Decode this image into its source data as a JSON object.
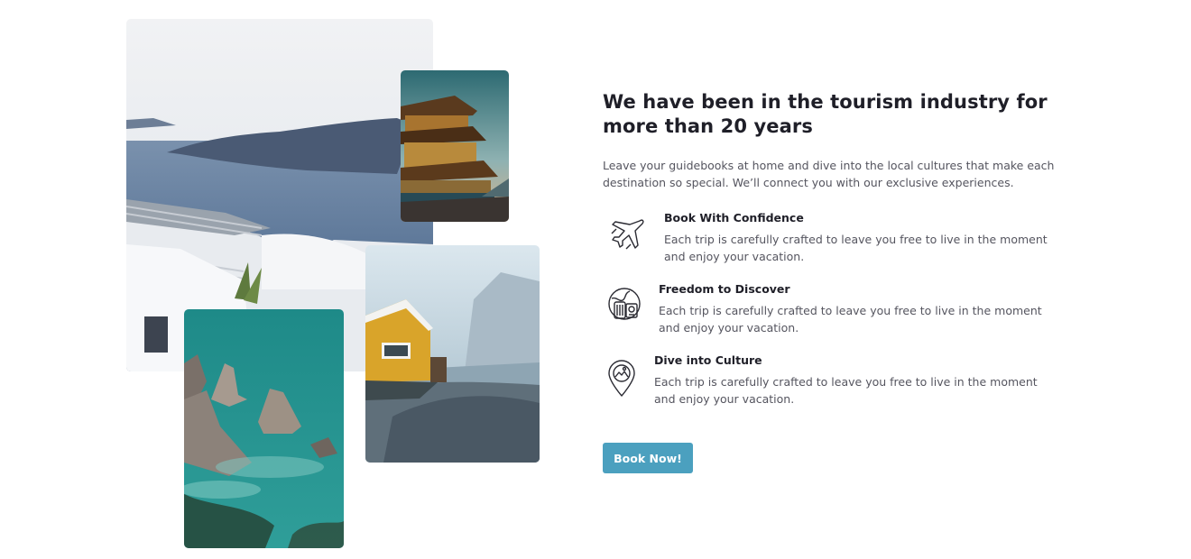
{
  "about": {
    "headline": "We have been in the tourism industry for more than 20 years",
    "intro": "Leave your guidebooks at home and dive into the local cultures that make each destination so special. We’ll connect you with our exclusive experiences."
  },
  "features": [
    {
      "icon": "airplane-icon",
      "title": "Book With Confidence",
      "description": "Each trip is carefully crafted to leave you free to live in the moment and enjoy your vacation."
    },
    {
      "icon": "travel-globe-luggage-icon",
      "title": "Freedom to Discover",
      "description": "Each trip is carefully crafted to leave you free to live in the moment and enjoy your vacation."
    },
    {
      "icon": "map-pin-picture-icon",
      "title": "Dive into Culture",
      "description": "Each trip is carefully crafted to leave you free to live in the moment and enjoy your vacation."
    }
  ],
  "cta": {
    "label": "Book Now!",
    "color": "#4ba0bf"
  },
  "photos": [
    "santorini-coast-photo",
    "temple-photo",
    "yellow-house-photo",
    "sea-rocks-photo"
  ]
}
